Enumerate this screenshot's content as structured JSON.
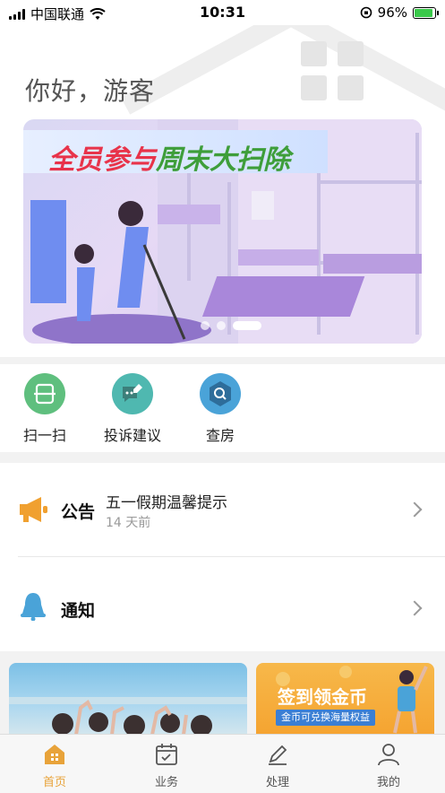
{
  "status_bar": {
    "carrier": "中国联通",
    "time": "10:31",
    "battery": "96%"
  },
  "header": {
    "greeting": "你好，游客"
  },
  "banner": {
    "title_part1": "全员参与",
    "title_part2": "周末大扫除",
    "title_color1": "#e8334a",
    "title_color2": "#3e9e3a",
    "slide_count": 3,
    "active_slide": 3
  },
  "quick_actions": [
    {
      "label": "扫一扫",
      "icon": "scan-icon",
      "color": "#5fbf7e"
    },
    {
      "label": "投诉建议",
      "icon": "message-edit-icon",
      "color": "#4fb8b0"
    },
    {
      "label": "查房",
      "icon": "search-icon",
      "color": "#4aa3d8"
    }
  ],
  "notices": {
    "announcement": {
      "label": "公告",
      "title": "五一假期温馨提示",
      "time": "14 天前",
      "icon": "megaphone-icon",
      "icon_color": "#f0a030"
    },
    "notification": {
      "label": "通知",
      "icon": "bell-icon",
      "icon_color": "#4aa3d8"
    }
  },
  "promos": {
    "right_title": "签到领金币",
    "right_subtitle": "金币可兑换海量权益"
  },
  "tabbar": {
    "items": [
      {
        "label": "首页",
        "icon": "home-icon"
      },
      {
        "label": "业务",
        "icon": "calendar-icon"
      },
      {
        "label": "处理",
        "icon": "pen-icon"
      },
      {
        "label": "我的",
        "icon": "user-icon"
      }
    ],
    "active": "首页",
    "active_color": "#e8a33a"
  }
}
